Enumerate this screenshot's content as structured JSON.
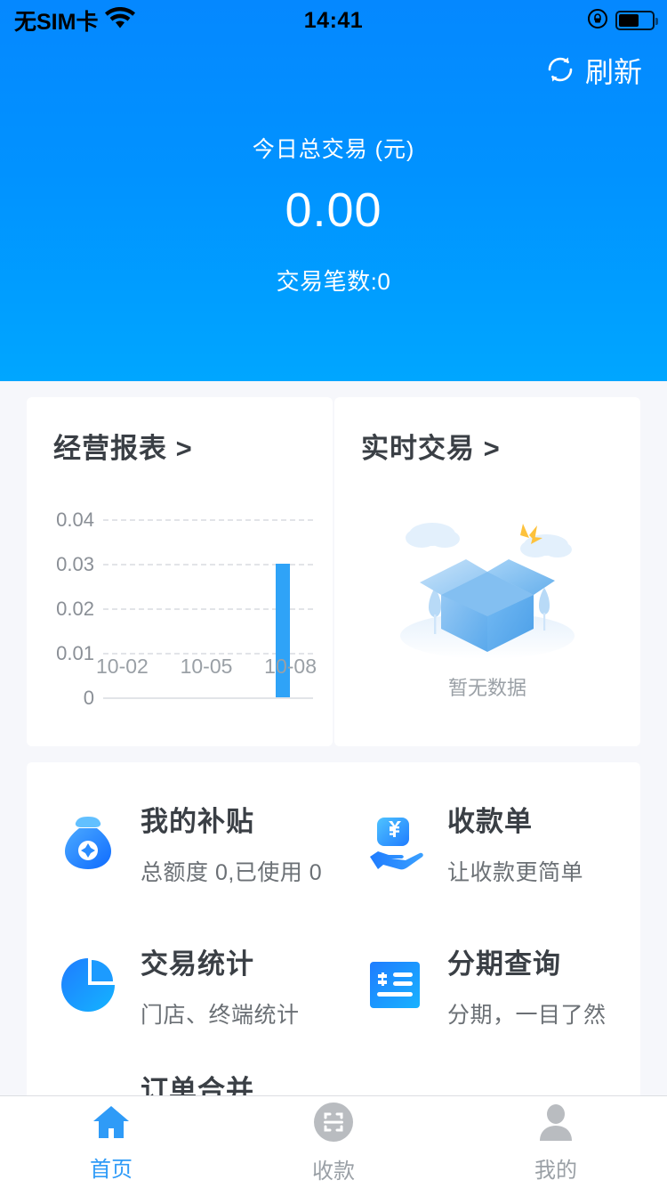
{
  "status_bar": {
    "carrier": "无SIM卡",
    "wifi_icon": "wifi-icon",
    "time": "14:41",
    "lock_icon": "rotation-lock-icon",
    "battery_icon": "battery-icon"
  },
  "header": {
    "refresh_icon": "refresh-icon",
    "refresh_label": "刷新",
    "title": "今日总交易 (元)",
    "amount": "0.00",
    "count_label": "交易笔数:0",
    "gradient_top": "#0588ff",
    "gradient_bottom": "#00a6ff"
  },
  "report_card": {
    "title": "经营报表 >",
    "chevron": ">"
  },
  "realtime_card": {
    "title": "实时交易 >",
    "empty_text": "暂无数据",
    "empty_icon": "empty-box-illustration"
  },
  "chart_data": {
    "type": "bar",
    "title": "经营报表",
    "categories": [
      "10-02",
      "10-05",
      "10-08"
    ],
    "values": [
      0,
      0,
      0.03
    ],
    "xlabel": "",
    "ylabel": "",
    "ylim": [
      0,
      0.04
    ],
    "yticks": [
      "0.04",
      "0.03",
      "0.02",
      "0.01",
      "0"
    ],
    "ytick_values": [
      0.04,
      0.03,
      0.02,
      0.01,
      0
    ],
    "grid": true,
    "legend": false,
    "bar_color": "#2fa3f7",
    "grid_color": "#e2e4e8"
  },
  "menu": {
    "items": [
      {
        "icon": "money-bag-icon",
        "title": "我的补贴",
        "sub": "总额度 0,已使用 0"
      },
      {
        "icon": "hand-card-yen-icon",
        "title": "收款单",
        "sub": "让收款更简单"
      },
      {
        "icon": "pie-chart-icon",
        "title": "交易统计",
        "sub": "门店、终端统计"
      },
      {
        "icon": "receipt-icon",
        "title": "分期查询",
        "sub": "分期，一目了然"
      },
      {
        "icon": "merge-order-icon",
        "title": "订单合并",
        "sub": ""
      }
    ]
  },
  "tabbar": {
    "tabs": [
      {
        "icon": "home-icon",
        "label": "首页",
        "active": true
      },
      {
        "icon": "scan-pay-icon",
        "label": "收款",
        "active": false
      },
      {
        "icon": "person-icon",
        "label": "我的",
        "active": false
      }
    ],
    "active_color": "#2f9bf7",
    "inactive_color": "#9aa0a6"
  }
}
